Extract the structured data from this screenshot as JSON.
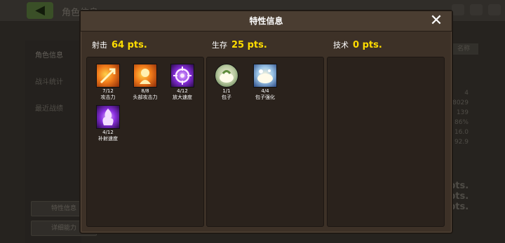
{
  "background": {
    "title": "角色信息",
    "sidebar": [
      "角色信息",
      "战斗统计",
      "最近战绩"
    ],
    "side_buttons": [
      "特性信息",
      "详细能力"
    ],
    "tab": "名称",
    "numbers": [
      "4",
      "8029",
      "139",
      "86%",
      "16.0",
      "92.9"
    ],
    "big_numbers": [
      "pts.",
      "pts.",
      "pts."
    ]
  },
  "modal": {
    "title": "特性信息",
    "close": "✕"
  },
  "panels": [
    {
      "label": "射击",
      "points": "64 pts.",
      "traits": [
        {
          "count": "7/12",
          "name": "攻击力",
          "icon": "arrow-burst-icon",
          "style": "orange"
        },
        {
          "count": "8/8",
          "name": "头部攻击力",
          "icon": "head-target-icon",
          "style": "orange"
        },
        {
          "count": "4/12",
          "name": "放大速度",
          "icon": "crosshair-icon",
          "style": "purple"
        },
        {
          "count": "4/12",
          "name": "补射速度",
          "icon": "flame-fist-icon",
          "style": "purple"
        }
      ]
    },
    {
      "label": "生存",
      "points": "25 pts.",
      "traits": [
        {
          "count": "1/1",
          "name": "包子",
          "icon": "bun-icon",
          "style": "round"
        },
        {
          "count": "4/4",
          "name": "包子强化",
          "icon": "bun-upgrade-icon",
          "style": "blue"
        }
      ]
    },
    {
      "label": "技术",
      "points": "0 pts.",
      "traits": []
    }
  ],
  "colors": {
    "points": "#ffdd00",
    "modal_bg": "#3d3127",
    "panel_bg": "#2a221c"
  }
}
